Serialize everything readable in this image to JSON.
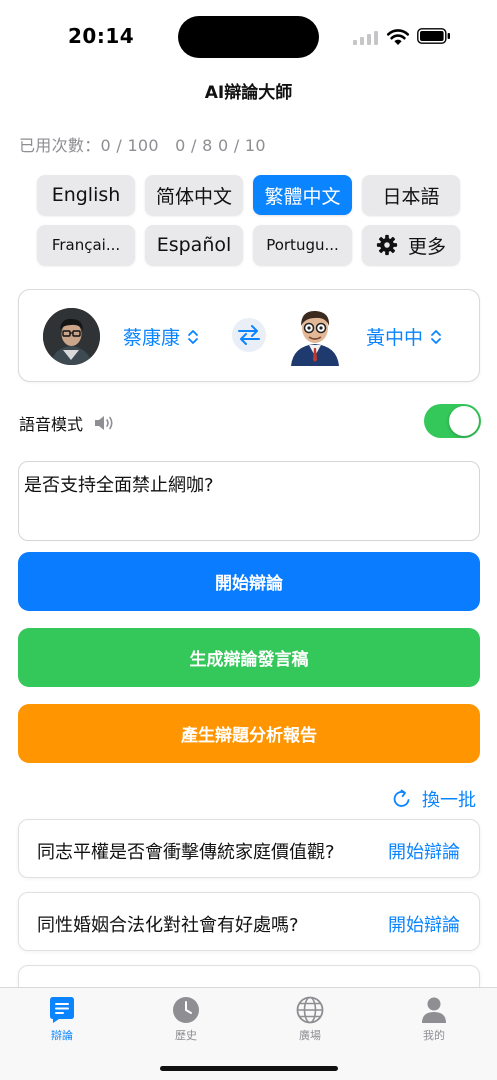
{
  "status_bar": {
    "time": "20:14"
  },
  "nav": {
    "title": "AI辯論大師"
  },
  "usage": {
    "text": "已用次數：0 / 100　0 / 8  0 / 10"
  },
  "languages": [
    {
      "label": "English",
      "selected": false
    },
    {
      "label": "简体中文",
      "selected": false
    },
    {
      "label": "繁體中文",
      "selected": true
    },
    {
      "label": "日本語",
      "selected": false
    },
    {
      "label": "Françai...",
      "selected": false
    },
    {
      "label": "Español",
      "selected": false
    },
    {
      "label": "Portugu...",
      "selected": false
    },
    {
      "label": "更多",
      "selected": false,
      "icon": "gear-icon"
    }
  ],
  "debaters": {
    "left": {
      "name": "蔡康康"
    },
    "right": {
      "name": "黃中中"
    }
  },
  "voice_mode": {
    "label": "語音模式",
    "enabled": true
  },
  "topic": {
    "value": "是否支持全面禁止網咖?"
  },
  "actions": {
    "start": "開始辯論",
    "generate_speech": "生成辯論發言稿",
    "analysis_report": "產生辯題分析報告"
  },
  "suggestions": {
    "refresh_label": "換一批",
    "items": [
      {
        "topic": "同志平權是否會衝擊傳統家庭價值觀?",
        "action": "開始辯論"
      },
      {
        "topic": "同性婚姻合法化對社會有好處嗎?",
        "action": "開始辯論"
      }
    ]
  },
  "tab_bar": {
    "tabs": [
      {
        "label": "辯論",
        "icon": "chat-icon",
        "active": true
      },
      {
        "label": "歷史",
        "icon": "clock-icon",
        "active": false
      },
      {
        "label": "廣場",
        "icon": "globe-icon",
        "active": false
      },
      {
        "label": "我的",
        "icon": "person-icon",
        "active": false
      }
    ]
  },
  "colors": {
    "accent": "#0a84ff",
    "start_button": "#0a7cff",
    "speech_button": "#34c759",
    "report_button": "#ff9500",
    "toggle_on": "#34c759"
  }
}
